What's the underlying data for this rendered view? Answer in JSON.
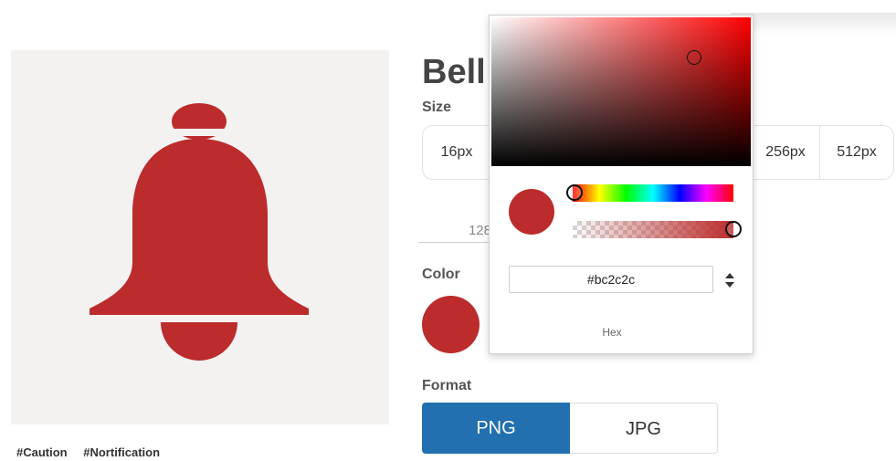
{
  "icon": {
    "title": "Bell",
    "color": "#bc2c2c"
  },
  "tags": [
    "#Caution",
    "#Nortification"
  ],
  "size": {
    "label": "Size",
    "options_visible": [
      "16px",
      "256px",
      "512px"
    ],
    "custom_value": "128"
  },
  "color_section": {
    "label": "Color",
    "value": "#bc2c2c"
  },
  "format": {
    "label": "Format",
    "options": [
      "PNG",
      "JPG"
    ],
    "selected": "PNG"
  },
  "picker": {
    "hex_value": "#bc2c2c",
    "mode_label": "Hex",
    "alpha": 1.0
  },
  "colors": {
    "accent": "#2270b0",
    "swatch": "#bc2c2c",
    "panel_bg": "#f3f2f1"
  }
}
